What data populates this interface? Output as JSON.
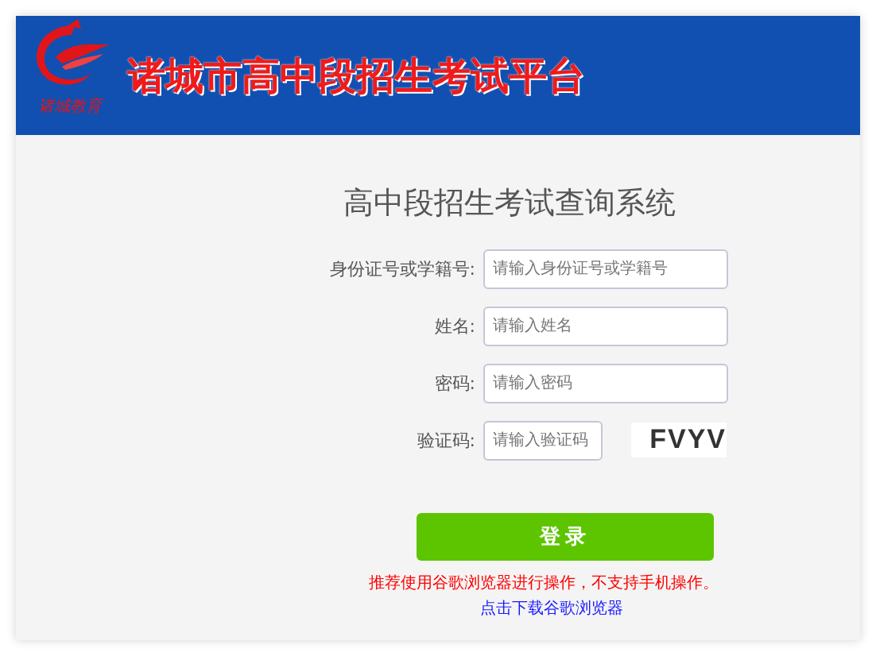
{
  "header": {
    "logo_text": "诸城教育",
    "title": "诸城市高中段招生考试平台"
  },
  "form": {
    "heading": "高中段招生考试查询系统",
    "fields": [
      {
        "kind": "text",
        "label": "身份证号或学籍号:",
        "placeholder": "请输入身份证号或学籍号"
      },
      {
        "kind": "text",
        "label": "姓名:",
        "placeholder": "请输入姓名"
      },
      {
        "kind": "password",
        "label": "密码:",
        "placeholder": "请输入密码"
      },
      {
        "kind": "captcha",
        "label": "验证码:",
        "placeholder": "请输入验证码",
        "captcha": "FVYV"
      }
    ],
    "submit": "登录",
    "notice": "推荐使用谷歌浏览器进行操作，不支持手机操作。",
    "download_link": "点击下载谷歌浏览器"
  }
}
